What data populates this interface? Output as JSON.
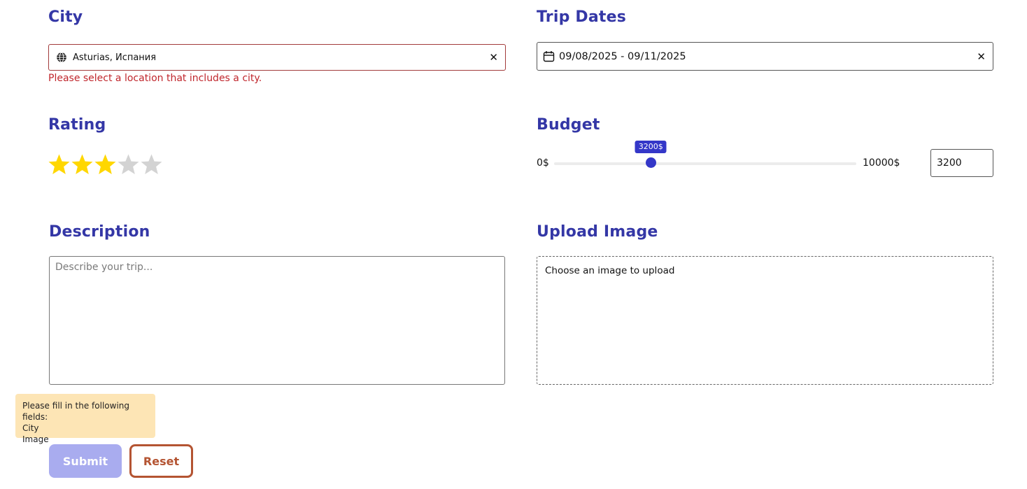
{
  "city": {
    "label": "City",
    "value": "Asturias, Испания",
    "error": "Please select a location that includes a city."
  },
  "trip_dates": {
    "label": "Trip Dates",
    "value": "09/08/2025 - 09/11/2025"
  },
  "rating": {
    "label": "Rating",
    "value": 3,
    "max": 5,
    "filled_color": "#ffd700",
    "empty_color": "#d3d3d3"
  },
  "budget": {
    "label": "Budget",
    "min_label": "0$",
    "max_label": "10000$",
    "min": 0,
    "max": 10000,
    "value": 3200,
    "tooltip": "3200$",
    "input_value": "3200"
  },
  "description": {
    "label": "Description",
    "placeholder": "Describe your trip..."
  },
  "upload": {
    "label": "Upload Image",
    "prompt": "Choose an image to upload"
  },
  "warning": {
    "heading": "Please fill in the following fields:",
    "fields": [
      "City",
      "Image"
    ]
  },
  "buttons": {
    "submit": "Submit",
    "reset": "Reset"
  },
  "colors": {
    "accent": "#3437a6",
    "error": "#c0262c",
    "slider": "#3437c8",
    "reset": "#b45432",
    "submit_disabled": "#a9acef",
    "warning_bg": "#fde5b5"
  },
  "icons": {
    "city_field": "globe-icon",
    "date_field": "calendar-icon",
    "clear": "close-icon"
  }
}
